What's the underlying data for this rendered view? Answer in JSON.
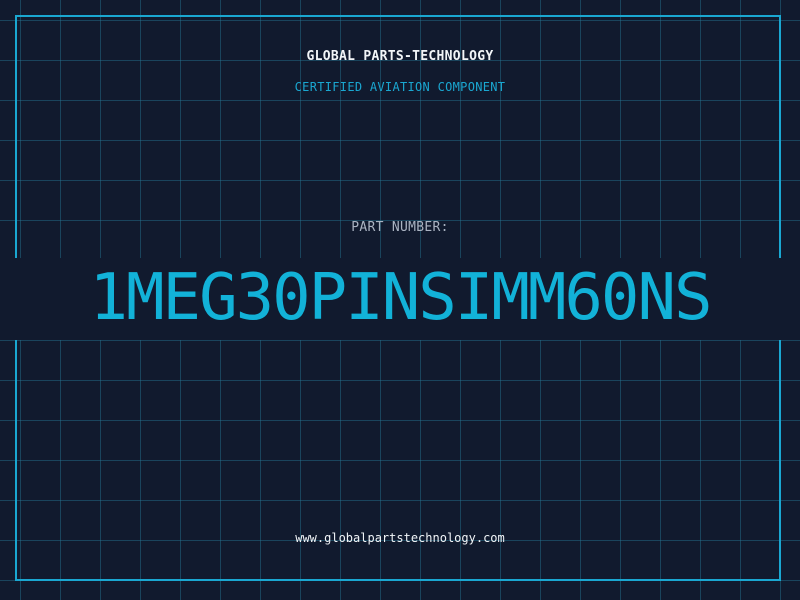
{
  "label": {
    "company": "GLOBAL PARTS-TECHNOLOGY",
    "certification": "CERTIFIED AVIATION COMPONENT",
    "part_number_label": "PART NUMBER:",
    "part_number": "1MEG30PINSIMM60NS",
    "website": "www.globalpartstechnology.com"
  },
  "colors": {
    "background": "#111a2e",
    "grid": "#26788f",
    "accent": "#1aa7d1",
    "part_number": "#12b2d8",
    "text": "#f2f5f8",
    "muted": "#aab3c2"
  }
}
